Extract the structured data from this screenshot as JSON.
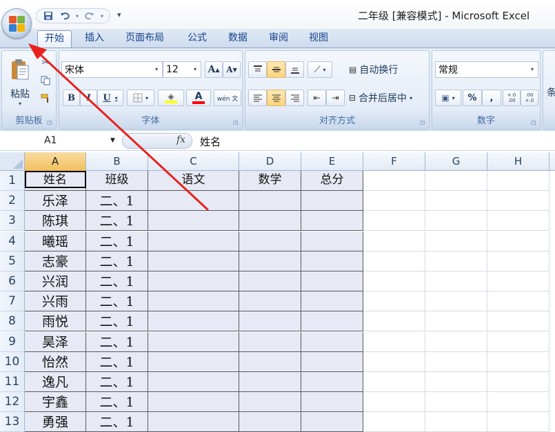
{
  "window": {
    "title": "二年级  [兼容模式] - Microsoft Excel",
    "office_button_icon": "office-logo-icon"
  },
  "quick_access": {
    "save_icon": "save-icon",
    "undo_icon": "undo-icon",
    "redo_icon": "redo-icon",
    "customize_icon": "customize-toolbar-icon"
  },
  "tabs": [
    {
      "label": "开始",
      "active": true
    },
    {
      "label": "插入"
    },
    {
      "label": "页面布局"
    },
    {
      "label": "公式"
    },
    {
      "label": "数据"
    },
    {
      "label": "审阅"
    },
    {
      "label": "视图"
    }
  ],
  "ribbon": {
    "clipboard": {
      "label": "剪贴板",
      "paste_label": "粘贴"
    },
    "font": {
      "label": "字体",
      "font_name": "宋体",
      "font_size": "12",
      "bold": "B",
      "italic": "I",
      "underline": "U",
      "grow": "A",
      "shrink": "A",
      "font_color_letter": "A",
      "phonetic": "wén 文",
      "fill_color": "#ffff00",
      "font_color": "#ff0000"
    },
    "alignment": {
      "label": "对齐方式",
      "wrap_text": "自动换行",
      "merge_center": "合并后居中"
    },
    "number": {
      "label": "数字",
      "format": "常规",
      "percent": "%",
      "comma": ",",
      "inc_decimal": "+.0 .00",
      "dec_decimal": ".00 +.0"
    },
    "styles_partial": "条"
  },
  "formula_bar": {
    "name_box": "A1",
    "fx": "fx",
    "formula": "姓名"
  },
  "sheet": {
    "columns": [
      "A",
      "B",
      "C",
      "D",
      "E",
      "F",
      "G",
      "H"
    ],
    "selected_column": "A",
    "rows": [
      {
        "num": "1",
        "cells": [
          "姓名",
          "班级",
          "语文",
          "数学",
          "总分"
        ]
      },
      {
        "num": "2",
        "cells": [
          "乐泽",
          "二、1",
          "",
          "",
          ""
        ]
      },
      {
        "num": "3",
        "cells": [
          "陈琪",
          "二、1",
          "",
          "",
          ""
        ]
      },
      {
        "num": "4",
        "cells": [
          "曦瑶",
          "二、1",
          "",
          "",
          ""
        ]
      },
      {
        "num": "5",
        "cells": [
          "志豪",
          "二、1",
          "",
          "",
          ""
        ]
      },
      {
        "num": "6",
        "cells": [
          "兴润",
          "二、1",
          "",
          "",
          ""
        ]
      },
      {
        "num": "7",
        "cells": [
          "兴雨",
          "二、1",
          "",
          "",
          ""
        ]
      },
      {
        "num": "8",
        "cells": [
          "雨悦",
          "二、1",
          "",
          "",
          ""
        ]
      },
      {
        "num": "9",
        "cells": [
          "昊泽",
          "二、1",
          "",
          "",
          ""
        ]
      },
      {
        "num": "10",
        "cells": [
          "怡然",
          "二、1",
          "",
          "",
          ""
        ]
      },
      {
        "num": "11",
        "cells": [
          "逸凡",
          "二、1",
          "",
          "",
          ""
        ]
      },
      {
        "num": "12",
        "cells": [
          "宇鑫",
          "二、1",
          "",
          "",
          ""
        ]
      },
      {
        "num": "13",
        "cells": [
          "勇强",
          "二、1",
          "",
          "",
          ""
        ]
      }
    ],
    "data_fill": "#e7eaf5"
  },
  "annotation": {
    "color": "#e8211b"
  }
}
